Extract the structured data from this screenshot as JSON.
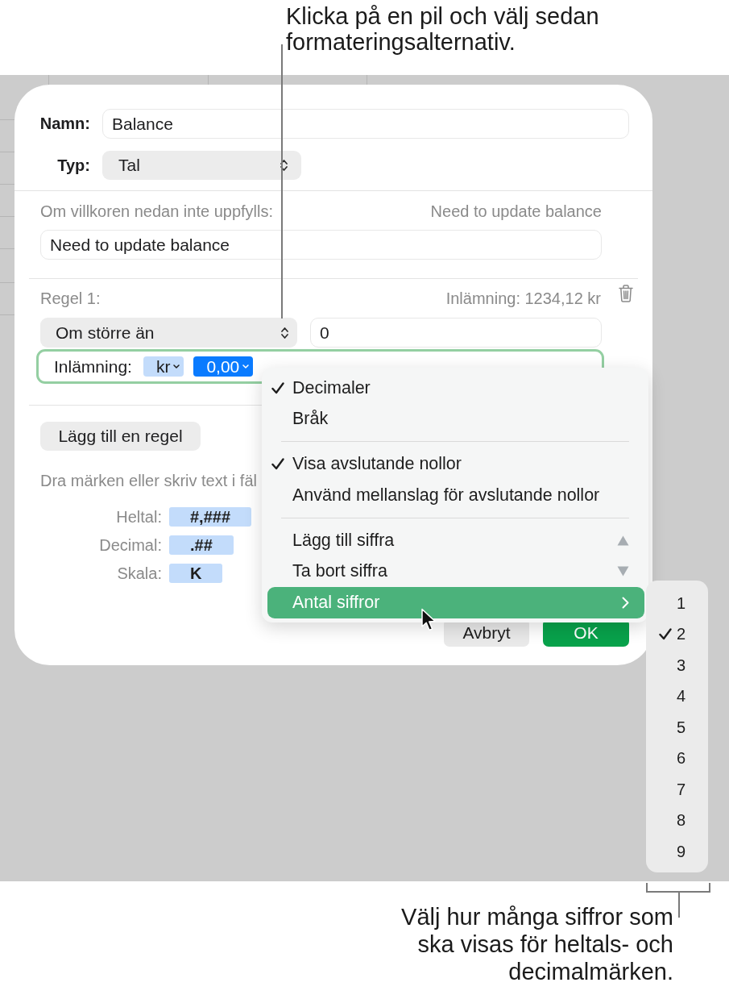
{
  "callout_top": {
    "lines": [
      "Klicka på en pil och välj sedan",
      "formateringsalternativ."
    ]
  },
  "dialog": {
    "name_field": {
      "label": "Namn:",
      "value": "Balance"
    },
    "type_popup": {
      "label": "Typ:",
      "value": "Tal"
    },
    "fallback": {
      "label": "Om villkoren nedan inte uppfylls:",
      "preview": "Need to update balance",
      "value": "Need to update balance"
    },
    "rule": {
      "label": "Regel 1:",
      "preview": "Inlämning: 1234,12 kr",
      "condition": "Om större än",
      "value": "0",
      "format": {
        "label": "Inlämning:",
        "focused": true,
        "tokens": [
          {
            "text": "kr",
            "selected": false
          },
          {
            "text": "0,00",
            "selected": true
          }
        ]
      }
    },
    "add_rule_button": "Lägg till en regel",
    "hint": "Dra märken eller skriv text i fäl",
    "token_rows": [
      {
        "label": "Heltal:",
        "token": "#,###"
      },
      {
        "label": "Decimal:",
        "token": ".##"
      },
      {
        "label": "Skala:",
        "token": "K"
      }
    ],
    "buttons": [
      {
        "label": "Avbryt",
        "kind": "cancel"
      },
      {
        "label": "OK",
        "kind": "default"
      }
    ]
  },
  "menu": {
    "sections": [
      {
        "items": [
          {
            "label": "Decimaler",
            "kind": "option",
            "checked": true,
            "selected": false
          },
          {
            "label": "Bråk",
            "kind": "option",
            "checked": false,
            "selected": false
          }
        ]
      },
      {
        "items": [
          {
            "label": "Visa avslutande nollor",
            "kind": "option",
            "checked": true,
            "selected": false
          },
          {
            "label": "Använd mellanslag för avslutande nollor",
            "kind": "option",
            "checked": false,
            "selected": false
          }
        ]
      },
      {
        "items": [
          {
            "label": "Lägg till siffra",
            "kind": "increase",
            "checked": false,
            "selected": false
          },
          {
            "label": "Ta bort siffra",
            "kind": "decrease",
            "checked": false,
            "selected": false
          },
          {
            "label": "Antal siffror",
            "kind": "submenu",
            "checked": false,
            "selected": true
          }
        ]
      }
    ]
  },
  "submenu": {
    "items": [
      {
        "label": "1",
        "checked": false
      },
      {
        "label": "2",
        "checked": true
      },
      {
        "label": "3",
        "checked": false
      },
      {
        "label": "4",
        "checked": false
      },
      {
        "label": "5",
        "checked": false
      },
      {
        "label": "6",
        "checked": false
      },
      {
        "label": "7",
        "checked": false
      },
      {
        "label": "8",
        "checked": false
      },
      {
        "label": "9",
        "checked": false
      }
    ]
  },
  "callout_bottom": {
    "lines": [
      "Välj hur många siffror som",
      "ska visas för heltals- och",
      "decimalmärken."
    ]
  }
}
